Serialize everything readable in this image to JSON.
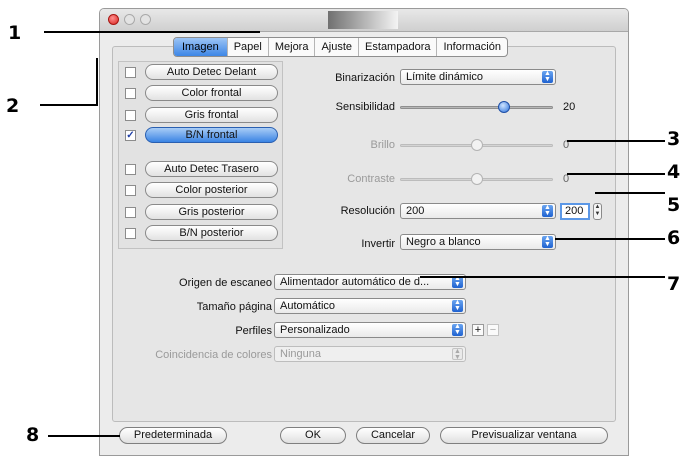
{
  "window": {
    "tabs": [
      "Imagen",
      "Papel",
      "Mejora",
      "Ajuste",
      "Estampadora",
      "Información"
    ],
    "active_tab": "Imagen"
  },
  "image_list": [
    {
      "label": "Auto Detec Delant",
      "checked": false
    },
    {
      "label": "Color frontal",
      "checked": false
    },
    {
      "label": "Gris frontal",
      "checked": false
    },
    {
      "label": "B/N frontal",
      "checked": true,
      "selected": true
    },
    {
      "label": "Auto Detec Trasero",
      "checked": false
    },
    {
      "label": "Color posterior",
      "checked": false
    },
    {
      "label": "Gris posterior",
      "checked": false
    },
    {
      "label": "B/N posterior",
      "checked": false
    }
  ],
  "settings": {
    "binarizacion": {
      "label": "Binarización",
      "value": "Límite dinámico"
    },
    "sensibilidad": {
      "label": "Sensibilidad",
      "value": "20",
      "level": 0.68
    },
    "brillo": {
      "label": "Brillo",
      "value": "0",
      "level": 0.5
    },
    "contraste": {
      "label": "Contraste",
      "value": "0",
      "level": 0.5
    },
    "resolucion": {
      "label": "Resolución",
      "value": "200",
      "field": "200"
    },
    "invertir": {
      "label": "Invertir",
      "value": "Negro a blanco"
    }
  },
  "scan": {
    "origen": {
      "label": "Origen de escaneo",
      "value": "Alimentador automático de d..."
    },
    "tamano": {
      "label": "Tamaño página",
      "value": "Automático"
    },
    "perfiles": {
      "label": "Perfiles",
      "value": "Personalizado",
      "add": "+",
      "remove": "−"
    },
    "coincidencia": {
      "label": "Coincidencia de colores",
      "value": "Ninguna"
    }
  },
  "buttons": {
    "default": "Predeterminada",
    "ok": "OK",
    "cancel": "Cancelar",
    "preview": "Previsualizar ventana"
  },
  "callouts": [
    "1",
    "2",
    "3",
    "4",
    "5",
    "6",
    "7",
    "8"
  ],
  "colors": {
    "accent": "#3d86e6",
    "close": "#d9241f"
  }
}
